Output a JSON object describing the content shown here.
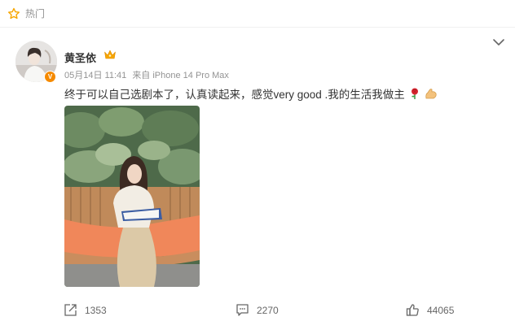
{
  "header": {
    "hot_label": "热门",
    "star_icon": "star-outline-icon"
  },
  "post": {
    "author": "黄圣依",
    "badge_text": "V",
    "timestamp": "05月14日 11:41",
    "source": "来自 iPhone 14 Pro Max",
    "text": "终于可以自己选剧本了，认真读起来，感觉very good .我的生活我做主",
    "emojis": [
      "rose-icon",
      "flexed-biceps-icon"
    ],
    "image": "photo-woman-reading-script-on-orange-bench"
  },
  "actions": {
    "repost_count": "1353",
    "comment_count": "2270",
    "like_count": "44065"
  },
  "colors": {
    "badge": "#f58a00",
    "crown": "#f7a600",
    "muted_text": "#939393",
    "bench": "#f0875a"
  }
}
